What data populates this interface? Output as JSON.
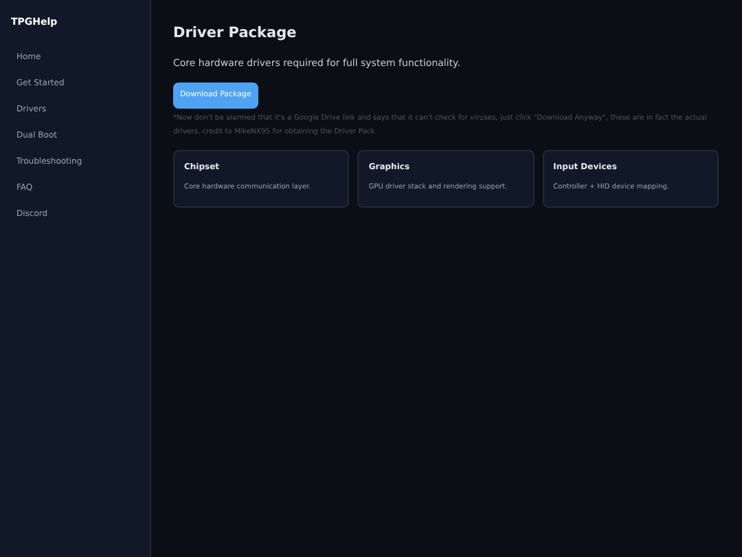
{
  "sidebar": {
    "brand": "TPGHelp",
    "items": [
      {
        "label": "Home"
      },
      {
        "label": "Get Started"
      },
      {
        "label": "Drivers"
      },
      {
        "label": "Dual Boot"
      },
      {
        "label": "Troubleshooting"
      },
      {
        "label": "FAQ"
      },
      {
        "label": "Discord"
      }
    ]
  },
  "main": {
    "title": "Driver Package",
    "subtitle": "Core hardware drivers required for full system functionality.",
    "button": "Download Package",
    "note": "*Now don't be alarmed that it's a Google Drive link and says that it can't check for viruses, just click \"Download Anyway\", these are in fact the actual drivers, credit to MikeNX95 for obtaining the Driver Pack",
    "cards": [
      {
        "title": "Chipset",
        "text": "Core hardware communication layer."
      },
      {
        "title": "Graphics",
        "text": "GPU driver stack and rendering support."
      },
      {
        "title": "Input Devices",
        "text": "Controller + HID device mapping."
      }
    ]
  }
}
